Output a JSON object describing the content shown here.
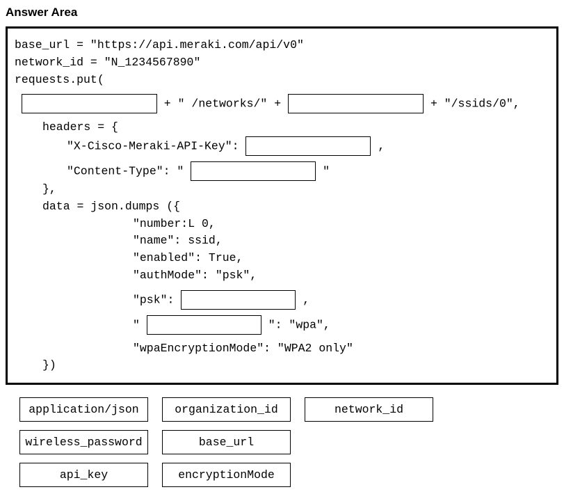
{
  "title": "Answer Area",
  "code": {
    "line1": "base_url = \"https://api.meraki.com/api/v0\"",
    "line2": "network_id = \"N_1234567890\"",
    "line3": "requests.put(",
    "concat1": " + \" /networks/\" + ",
    "concat2": " + \"/ssids/0\",",
    "headers_open": "headers = {",
    "api_key_label": "\"X-Cisco-Meraki-API-Key\": ",
    "api_key_comma": " ,",
    "content_type_open": "\"Content-Type\": \" ",
    "content_type_close": " \"",
    "brace_close_comma": "},",
    "data_open": "data = json.dumps ({",
    "number": "\"number:L 0,",
    "name_line": "\"name\": ssid,",
    "enabled": "\"enabled\": True,",
    "authmode": "\"authMode\": \"psk\",",
    "psk_open": "\"psk\": ",
    "psk_close": " ,",
    "quote_open": "\" ",
    "wpa_close": " \": \"wpa\",",
    "wpa_enc": "\"wpaEncryptionMode\": \"WPA2 only\"",
    "end": "})"
  },
  "options": {
    "r1c1": "application/json",
    "r1c2": "organization_id",
    "r1c3": "network_id",
    "r2c1": "wireless_password",
    "r2c2": "base_url",
    "r3c1": "api_key",
    "r3c2": "encryptionMode"
  }
}
